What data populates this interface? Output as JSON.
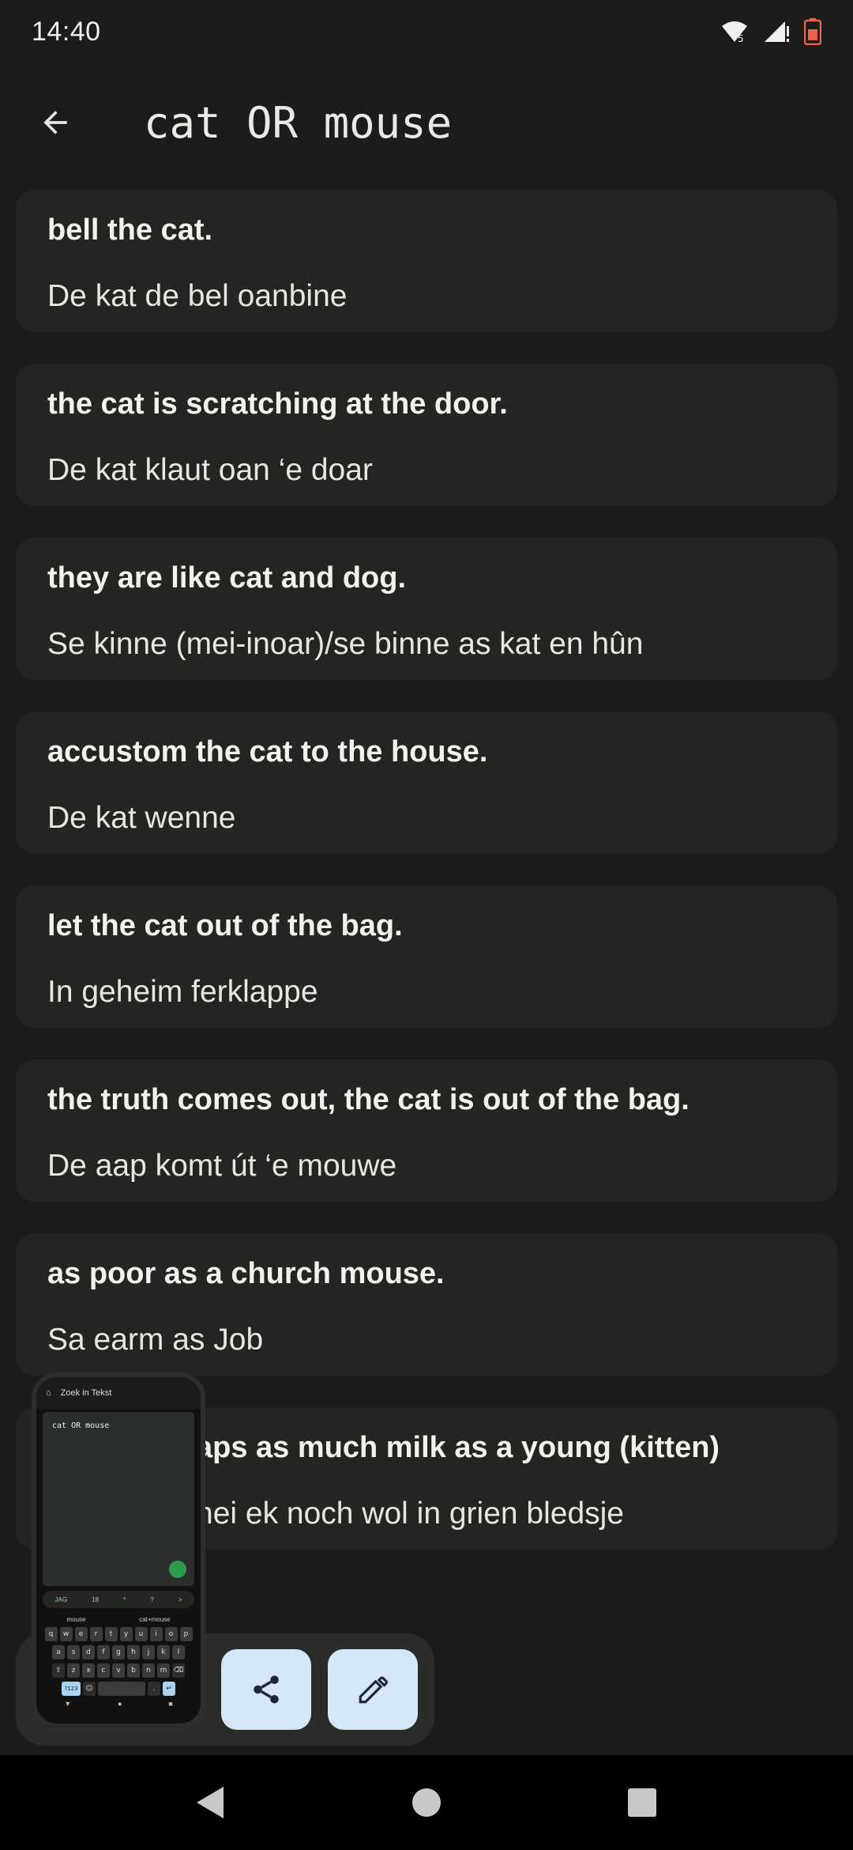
{
  "status": {
    "time": "14:40"
  },
  "search": {
    "query": "cat OR mouse"
  },
  "results": [
    {
      "en": "bell the cat.",
      "fy": "De kat de bel oanbine"
    },
    {
      "en": "the cat is scratching at the door.",
      "fy": "De kat klaut oan ‘e doar"
    },
    {
      "en": "they are like cat and dog.",
      "fy": "Se kinne (mei-inoar)/se binne as kat en hûn"
    },
    {
      "en": "accustom the cat to the house.",
      "fy": "De kat wenne"
    },
    {
      "en": "let the cat out of the bag.",
      "fy": "In geheim ferklappe"
    },
    {
      "en": "the truth comes out, the cat is out of the bag.",
      "fy": "De aap komt út ‘e mouwe"
    },
    {
      "en": "as poor as a church mouse.",
      "fy": "Sa earm as Job"
    },
    {
      "en": "aps as much milk as a young (kitten)",
      "fy": "nei ek noch wol in grien bledsje"
    }
  ],
  "preview": {
    "title": "Zoek in Tekst",
    "field_text": "cat OR mouse",
    "suggestions": [
      "JAG",
      "18",
      "*",
      "?",
      ">"
    ],
    "kbd_top": [
      "mouse",
      "cat+mouse"
    ],
    "row1": [
      "q",
      "w",
      "e",
      "r",
      "t",
      "y",
      "u",
      "i",
      "o",
      "p"
    ],
    "row2": [
      "a",
      "s",
      "d",
      "f",
      "g",
      "h",
      "j",
      "k",
      "l"
    ],
    "row3": [
      "z",
      "x",
      "c",
      "v",
      "b",
      "n",
      "m"
    ],
    "num_key": "?123"
  },
  "colors": {
    "fab_bg": "#d5e6f6",
    "card_bg": "#232523",
    "page_bg": "#1b1c1b"
  },
  "icons": {
    "back": "arrow-back-icon",
    "share": "share-icon",
    "edit": "pencil-icon",
    "wifi": "wifi-icon",
    "signal": "signal-icon",
    "battery": "battery-icon",
    "nav_back": "triangle-back-icon",
    "nav_home": "circle-home-icon",
    "nav_recents": "square-recents-icon"
  }
}
